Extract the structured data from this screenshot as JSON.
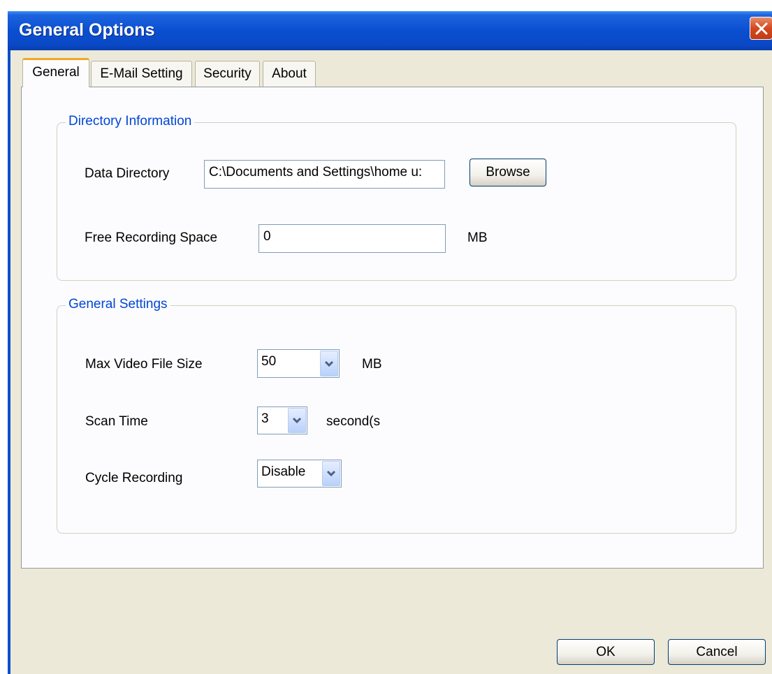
{
  "window": {
    "title": "General Options"
  },
  "tabs": [
    {
      "label": "General"
    },
    {
      "label": "E-Mail Setting"
    },
    {
      "label": "Security"
    },
    {
      "label": "About"
    }
  ],
  "directory_group": {
    "legend": "Directory Information",
    "data_directory_label": "Data Directory",
    "data_directory_value": "C:\\Documents and Settings\\home u:",
    "browse_label": "Browse",
    "free_space_label": "Free Recording Space",
    "free_space_value": "0",
    "free_space_unit": "MB"
  },
  "general_group": {
    "legend": "General Settings",
    "max_size_label": "Max Video File Size",
    "max_size_value": "50",
    "max_size_unit": "MB",
    "scan_time_label": "Scan Time",
    "scan_time_value": "3",
    "scan_time_unit": "second(s",
    "cycle_label": "Cycle Recording",
    "cycle_value": "Disable"
  },
  "buttons": {
    "ok": "OK",
    "cancel": "Cancel"
  },
  "icons": {
    "close": "close-icon",
    "dropdown": "chevron-down-icon"
  },
  "colors": {
    "titlebar": "#0a4fd0",
    "legend_text": "#0046d5",
    "active_tab_accent": "#f5a623"
  }
}
